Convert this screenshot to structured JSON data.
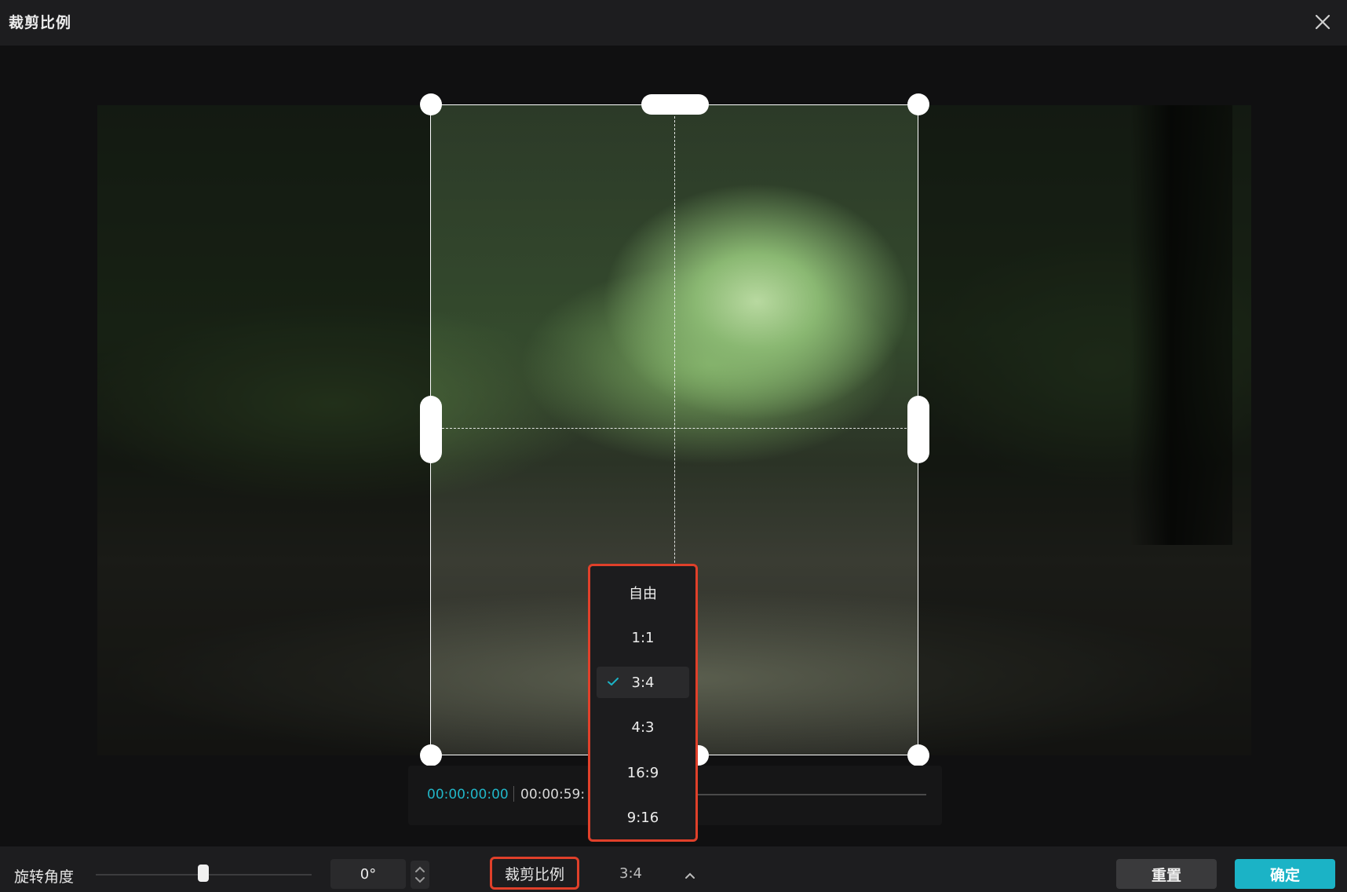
{
  "window": {
    "title": "裁剪比例",
    "close_icon": "close-icon"
  },
  "player": {
    "current_time": "00:00:00:00",
    "total_time": "00:00:59:"
  },
  "ratio_menu": {
    "items": [
      {
        "label": "自由",
        "selected": false
      },
      {
        "label": "1:1",
        "selected": false
      },
      {
        "label": "3:4",
        "selected": true
      },
      {
        "label": "4:3",
        "selected": false
      },
      {
        "label": "16:9",
        "selected": false
      },
      {
        "label": "9:16",
        "selected": false
      }
    ],
    "check_icon": "check-icon"
  },
  "toolbar": {
    "rotation_label": "旋转角度",
    "rotation_value": "0°",
    "ratio_label": "裁剪比例",
    "ratio_value": "3:4",
    "reset_label": "重置",
    "confirm_label": "确定"
  },
  "colors": {
    "accent": "#1bb3c6",
    "highlight_outline": "#e0402a",
    "timecode": "#21b6c8"
  }
}
